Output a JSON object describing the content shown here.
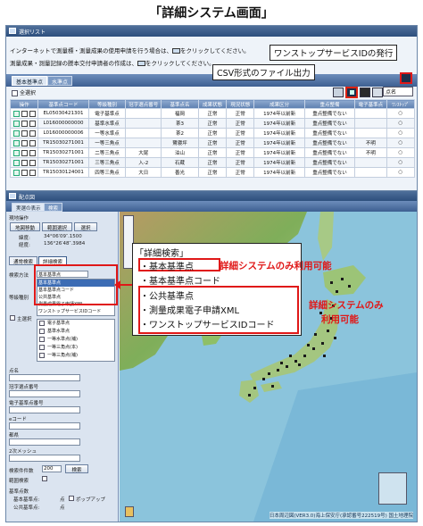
{
  "page_title": "「詳細システム画面」",
  "list_window": {
    "title": "選択リスト",
    "info_line_1": "インターネットで測量標・測量成果の使用申請を行う場合は、",
    "info_line_1b": "をクリックしてください。",
    "info_line_2": "測量成果・測量記録の謄本交付申請者の作成は、",
    "info_line_2b": "をクリックしてください。",
    "tabs": [
      "基本基準点",
      "水準点"
    ],
    "select_all_label": "全選択",
    "sort_option": "点名",
    "columns": [
      "操作",
      "基準点コード",
      "等級種別",
      "冠字選点番号",
      "基準点名",
      "成果状態",
      "現況状態",
      "成果区分",
      "重点整備",
      "電子基準点",
      "ﾜﾝｽﾄｯﾌﾟ"
    ],
    "rows": [
      [
        "",
        "EL05030421301",
        "電子基準点",
        "",
        "福岡",
        "正常",
        "正常",
        "1974年以前新",
        "重点整備でない",
        "",
        "○"
      ],
      [
        "",
        "L016000000000",
        "基準水準点",
        "",
        "茶3",
        "正常",
        "正常",
        "1974年以前新",
        "重点整備でない",
        "",
        "○"
      ],
      [
        "",
        "L016000000006",
        "一等水準点",
        "",
        "茶2",
        "正常",
        "正常",
        "1974年以前新",
        "重点整備でない",
        "",
        "○"
      ],
      [
        "",
        "TR15030271001",
        "一等三角点",
        "",
        "鷺寝坪",
        "正常",
        "正常",
        "1974年以前新",
        "重点整備でない",
        "不明",
        "○"
      ],
      [
        "",
        "TR15030271001",
        "二等三角点",
        "大尾",
        "泊山",
        "正常",
        "正常",
        "1974年以前新",
        "重点整備でない",
        "不明",
        "○"
      ],
      [
        "",
        "TR15030271001",
        "三等三角点",
        "入-2",
        "石蔵",
        "正常",
        "正常",
        "1974年以前新",
        "重点整備でない",
        "",
        "○"
      ],
      [
        "",
        "TR15030124001",
        "四等三角点",
        "大日",
        "善光",
        "正常",
        "正常",
        "1974年以前新",
        "重点整備でない",
        "",
        "○"
      ]
    ]
  },
  "callouts": {
    "onestop": "ワンストップサービスIDの発行",
    "csv": "CSV形式のファイル出力",
    "detail_search_title": "「詳細検索」",
    "detail_search_items": [
      "・基本基準点",
      "・基本基準点コード",
      "・公共基準点",
      "・測量成果電子申請XML",
      "・ワンストップサービスIDコード"
    ],
    "detail_only_1": "詳細システムのみ利用可能",
    "detail_only_2a": "詳細システムのみ",
    "detail_only_2b": "利用可能"
  },
  "map_window": {
    "title": "配点図",
    "tabs": [
      "実選の表示",
      "検索"
    ],
    "left_panel": {
      "section_op": "現地操作",
      "btn_move": "地図移動",
      "btn_range": "範囲選択",
      "btn_select": "選択",
      "lat_label": "緯度:",
      "lat_value": "34°06′09″.1500",
      "lon_label": "経度:",
      "lon_value": "136°26′48″.3984",
      "search_tabs": [
        "通常検索",
        "詳細検索"
      ],
      "search_method_label": "検索方法",
      "search_method_value": "基本基準点",
      "dropdown_options": [
        "基本基準点",
        "基本基準点コード",
        "公共基準点",
        "測量成果電子申請XML",
        "ワンストップサービスIDコード"
      ],
      "grade_label": "等級種別",
      "main_label": "主選択",
      "grade_items": [
        "電子基準点",
        "基準水準点",
        "一等水準点(補)",
        "一等三角点(本)",
        "一等三角点(補)"
      ],
      "point_name_label": "点名",
      "crown_label": "冠字選点番号",
      "ecode_label": "電子基準点番号",
      "e_code2_label": "eコード",
      "pref_label": "都県",
      "mesh_label": "2次メッシュ",
      "search_count_label": "検索件件数",
      "search_count_value": "200",
      "search_button": "検索",
      "range_label": "範囲検索",
      "legend_label": "基準点数",
      "legend_basic": "基本基準点:",
      "legend_public": "公共基準点:",
      "legend_basic_mark": "点",
      "legend_public_mark": "点",
      "popup_label": "ポップアップ"
    },
    "credit": "日本周辺図(VER3.0)海上保安庁(承認番号222519号) 国土地理院"
  },
  "colors": {
    "accent_red": "#e01818",
    "titlebar": "#2d4f7d",
    "sea": "#8bc4dc"
  }
}
